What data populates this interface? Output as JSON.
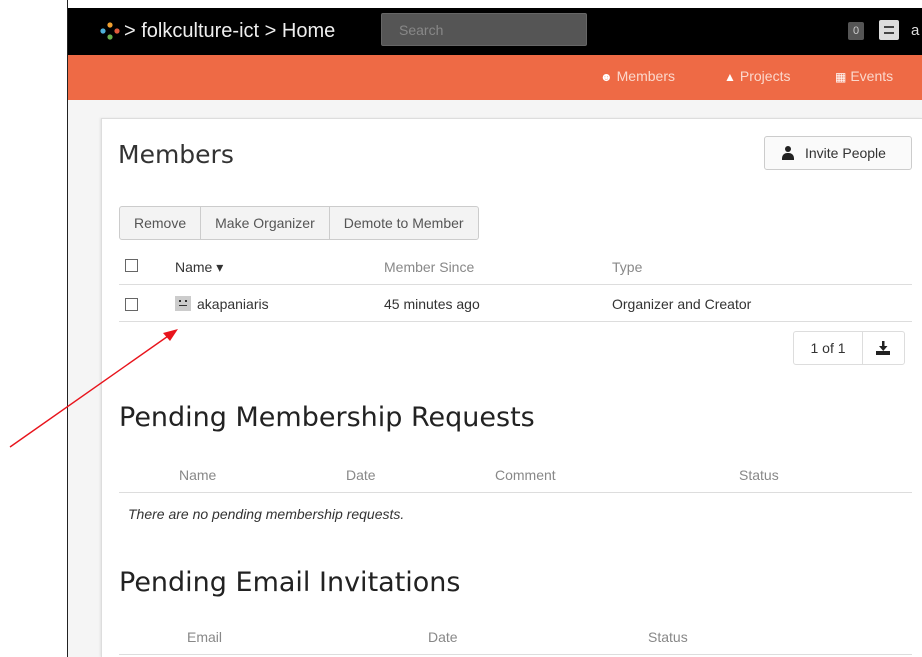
{
  "header": {
    "breadcrumb_separator_1": ">",
    "project": "folkculture-ict",
    "breadcrumb_separator_2": ">",
    "page": "Home",
    "search_placeholder": "Search",
    "notification_count": "0",
    "user_initial": "a"
  },
  "menu": {
    "items": [
      {
        "label": "Members",
        "icon": "users-icon"
      },
      {
        "label": "Projects",
        "icon": "sitemap-icon"
      },
      {
        "label": "Events",
        "icon": "calendar-icon"
      }
    ]
  },
  "members": {
    "title": "Members",
    "invite_label": "Invite People",
    "actions": [
      "Remove",
      "Make Organizer",
      "Demote to Member"
    ],
    "columns": [
      "Name ▾",
      "Member Since",
      "Type"
    ],
    "rows": [
      {
        "name": "akapaniaris",
        "since": "45 minutes ago",
        "type": "Organizer and Creator"
      }
    ],
    "pager": "1 of 1"
  },
  "pending_requests": {
    "title": "Pending Membership Requests",
    "columns": [
      "Name",
      "Date",
      "Comment",
      "Status"
    ],
    "empty_message": "There are no pending membership requests."
  },
  "pending_invites": {
    "title": "Pending Email Invitations",
    "columns": [
      "Email",
      "Date",
      "Status"
    ]
  },
  "colors": {
    "topbar": "#000000",
    "menubar": "#ee6a45",
    "annotation_arrow": "#e8141c"
  }
}
